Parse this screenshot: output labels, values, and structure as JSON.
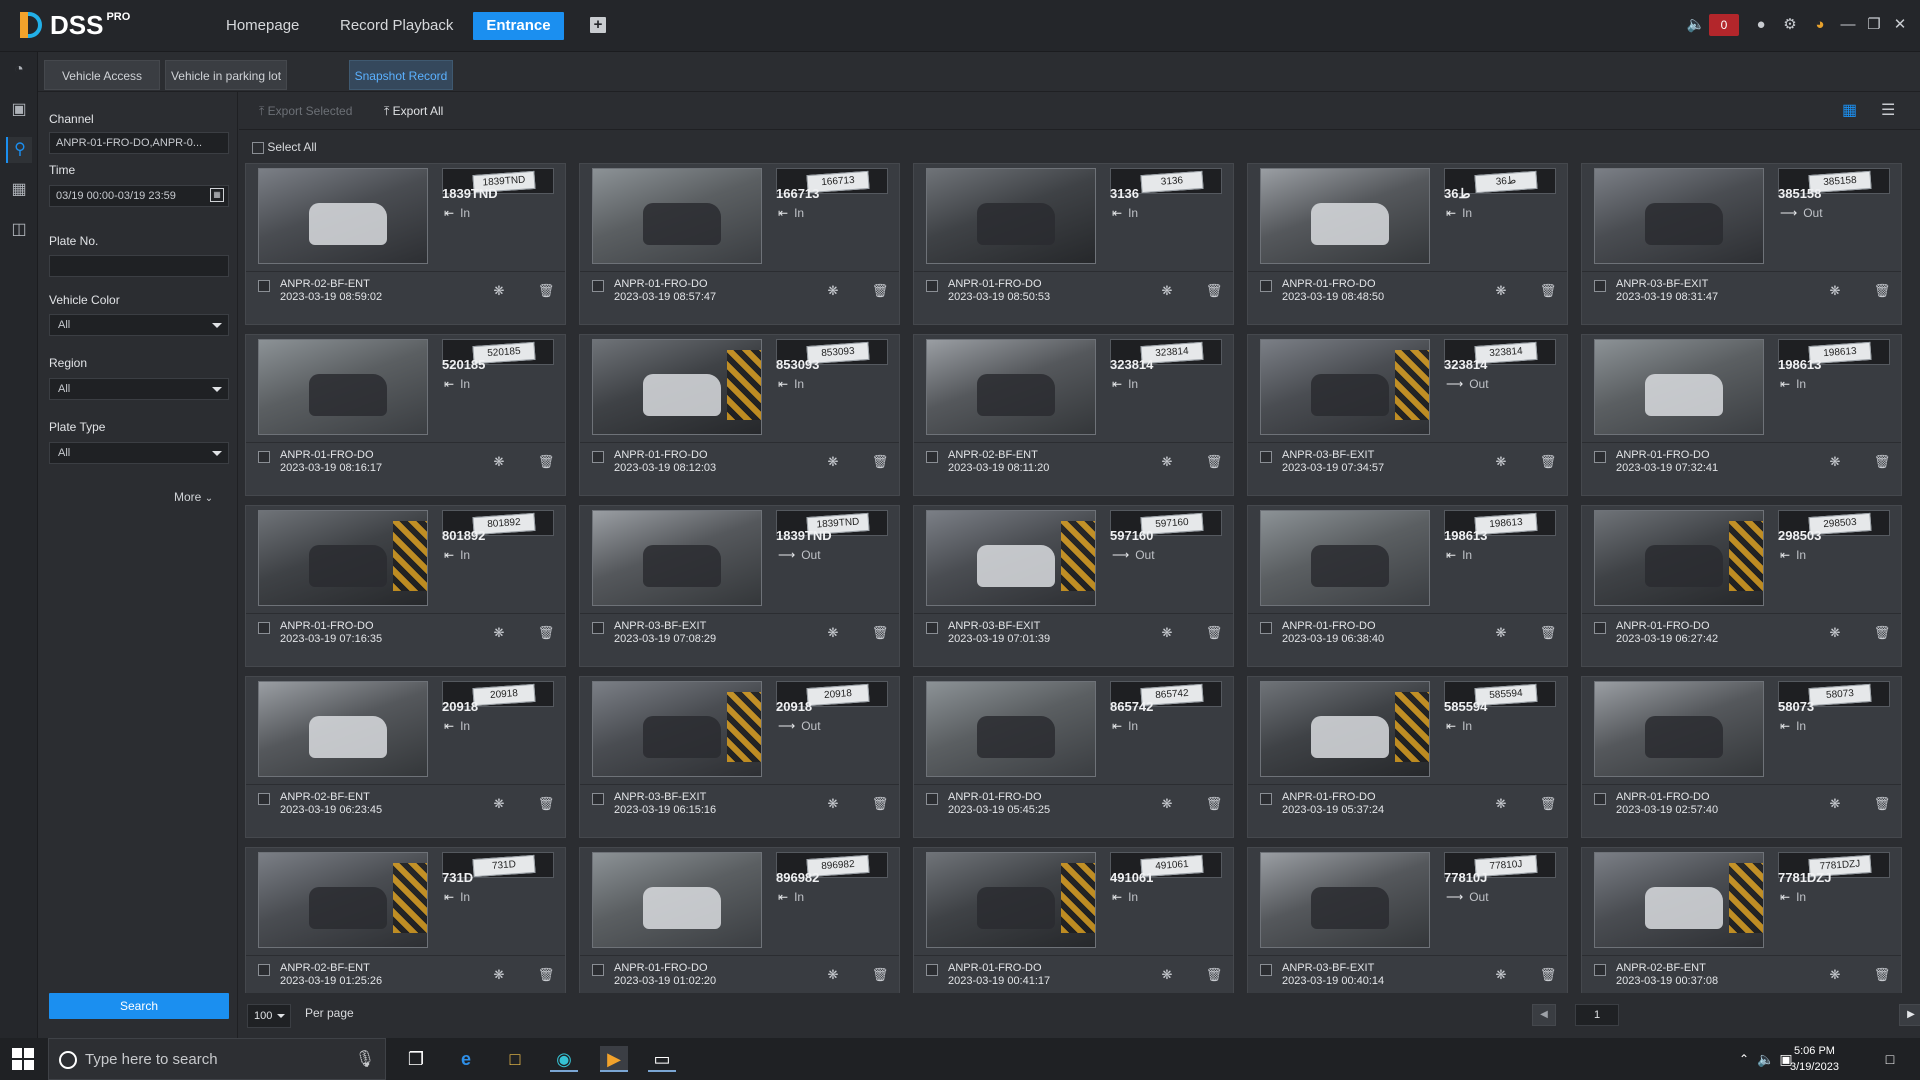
{
  "app": {
    "brand": "DSS",
    "brand_sup": "PRO"
  },
  "topnav": [
    "Homepage",
    "Record Playback",
    "Entrance"
  ],
  "alarm_count": "0",
  "subtabs": [
    "Vehicle Access",
    "Vehicle in parking lot",
    "Snapshot Record"
  ],
  "filters": {
    "channel_label": "Channel",
    "channel_value": "ANPR-01-FRO-DO,ANPR-0...",
    "time_label": "Time",
    "time_value": "03/19 00:00-03/19 23:59",
    "plate_label": "Plate No.",
    "plate_value": "",
    "color_label": "Vehicle Color",
    "color_value": "All",
    "region_label": "Region",
    "region_value": "All",
    "platetype_label": "Plate Type",
    "platetype_value": "All",
    "more_label": "More",
    "search_label": "Search"
  },
  "toolbar": {
    "export_selected": "Export Selected",
    "export_all": "Export All",
    "select_all": "Select All"
  },
  "records": [
    {
      "plate": "1839TND",
      "dir": "In",
      "channel": "ANPR-02-BF-ENT",
      "time": "2023-03-19 08:59:02"
    },
    {
      "plate": "166713",
      "dir": "In",
      "channel": "ANPR-01-FRO-DO",
      "time": "2023-03-19 08:57:47"
    },
    {
      "plate": "3136",
      "dir": "In",
      "channel": "ANPR-01-FRO-DO",
      "time": "2023-03-19 08:50:53"
    },
    {
      "plate": "36ط",
      "dir": "In",
      "channel": "ANPR-01-FRO-DO",
      "time": "2023-03-19 08:48:50"
    },
    {
      "plate": "385158",
      "dir": "Out",
      "channel": "ANPR-03-BF-EXIT",
      "time": "2023-03-19 08:31:47"
    },
    {
      "plate": "520185",
      "dir": "In",
      "channel": "ANPR-01-FRO-DO",
      "time": "2023-03-19 08:16:17"
    },
    {
      "plate": "853093",
      "dir": "In",
      "channel": "ANPR-01-FRO-DO",
      "time": "2023-03-19 08:12:03"
    },
    {
      "plate": "323814",
      "dir": "In",
      "channel": "ANPR-02-BF-ENT",
      "time": "2023-03-19 08:11:20"
    },
    {
      "plate": "323814",
      "dir": "Out",
      "channel": "ANPR-03-BF-EXIT",
      "time": "2023-03-19 07:34:57"
    },
    {
      "plate": "198613",
      "dir": "In",
      "channel": "ANPR-01-FRO-DO",
      "time": "2023-03-19 07:32:41"
    },
    {
      "plate": "801892",
      "dir": "In",
      "channel": "ANPR-01-FRO-DO",
      "time": "2023-03-19 07:16:35"
    },
    {
      "plate": "1839TND",
      "dir": "Out",
      "channel": "ANPR-03-BF-EXIT",
      "time": "2023-03-19 07:08:29"
    },
    {
      "plate": "597160",
      "dir": "Out",
      "channel": "ANPR-03-BF-EXIT",
      "time": "2023-03-19 07:01:39"
    },
    {
      "plate": "198613",
      "dir": "In",
      "channel": "ANPR-01-FRO-DO",
      "time": "2023-03-19 06:38:40"
    },
    {
      "plate": "298503",
      "dir": "In",
      "channel": "ANPR-01-FRO-DO",
      "time": "2023-03-19 06:27:42"
    },
    {
      "plate": "20918",
      "dir": "In",
      "channel": "ANPR-02-BF-ENT",
      "time": "2023-03-19 06:23:45"
    },
    {
      "plate": "20918",
      "dir": "Out",
      "channel": "ANPR-03-BF-EXIT",
      "time": "2023-03-19 06:15:16"
    },
    {
      "plate": "865742",
      "dir": "In",
      "channel": "ANPR-01-FRO-DO",
      "time": "2023-03-19 05:45:25"
    },
    {
      "plate": "585594",
      "dir": "In",
      "channel": "ANPR-01-FRO-DO",
      "time": "2023-03-19 05:37:24"
    },
    {
      "plate": "58073",
      "dir": "In",
      "channel": "ANPR-01-FRO-DO",
      "time": "2023-03-19 02:57:40"
    },
    {
      "plate": "731D",
      "dir": "In",
      "channel": "ANPR-02-BF-ENT",
      "time": "2023-03-19 01:25:26"
    },
    {
      "plate": "896982",
      "dir": "In",
      "channel": "ANPR-01-FRO-DO",
      "time": "2023-03-19 01:02:20"
    },
    {
      "plate": "491061",
      "dir": "In",
      "channel": "ANPR-01-FRO-DO",
      "time": "2023-03-19 00:41:17"
    },
    {
      "plate": "77810J",
      "dir": "Out",
      "channel": "ANPR-03-BF-EXIT",
      "time": "2023-03-19 00:40:14"
    },
    {
      "plate": "7781DZJ",
      "dir": "In",
      "channel": "ANPR-02-BF-ENT",
      "time": "2023-03-19 00:37:08"
    }
  ],
  "pager": {
    "per_page_value": "100",
    "per_page_label": "Per page",
    "page": "1"
  },
  "taskbar": {
    "search_placeholder": "Type here to search",
    "time": "5:06 PM",
    "date": "3/19/2023"
  },
  "colors": {
    "accent": "#1b8ff0",
    "alarm": "#b3262b"
  }
}
